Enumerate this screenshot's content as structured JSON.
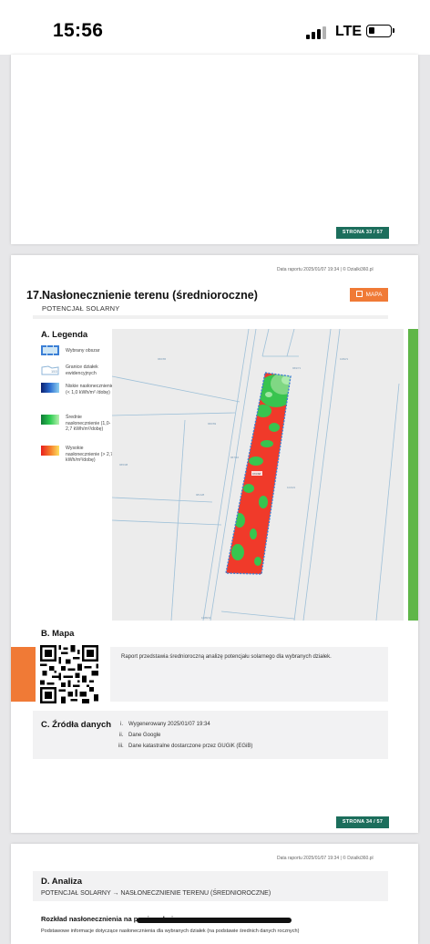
{
  "status_bar": {
    "time": "15:56",
    "network": "LTE",
    "icons": [
      "signal-icon",
      "battery-icon"
    ]
  },
  "page1": {
    "badge": "STRONA 33 / 57"
  },
  "page2": {
    "meta": "Data raportu 2025/01/07 19:34  |  © Dzialki360.pl",
    "section_number": "17.",
    "section_title": "Nasłonecznienie terenu (średnioroczne)",
    "section_subtitle": "POTENCJAŁ SOLARNY",
    "mapa_button": "MAPA",
    "legend": {
      "heading": "A. Legenda",
      "items": [
        {
          "label": "Wybrany obszar",
          "icon": "selected-area-icon"
        },
        {
          "label": "Granice działek ewidencyjnych",
          "icon": "parcel-boundary-icon"
        },
        {
          "label": "Niskie nasłonecznienie (< 1,0 kWh/m² /dobę)",
          "icon": "low-insolation-icon"
        },
        {
          "label": "Średnie nasłonecznienie (1,0- 2,7 kWh/m²/dobę)",
          "icon": "medium-insolation-icon"
        },
        {
          "label": "Wysokie nasłonecznienie (> 2,7 kWh/m²/dobę)",
          "icon": "high-insolation-icon"
        }
      ]
    },
    "map_heading": "B. Mapa",
    "map_description": "Raport przedstawia średnioroczną analizę potencjału solarnego dla wybranych działek.",
    "sources_heading": "C. Źródła danych",
    "sources": [
      {
        "num": "i.",
        "text": "Wygenerowany 2025/01/07 19:34"
      },
      {
        "num": "ii.",
        "text": "Dane Google"
      },
      {
        "num": "iii.",
        "text": "Dane katastralne dostarczone przez GUGiK (EGiB)"
      }
    ],
    "badge": "STRONA 34 / 57",
    "colors": {
      "low": "#1a3fa8",
      "medium": "#2ecc52",
      "high": "#f03a2a",
      "accent": "#f07a36",
      "badge": "#1c6e5c",
      "bar": "#5fb648"
    }
  },
  "page3": {
    "meta": "Data raportu 2025/01/07 19:34  |  © Dzialki360.pl",
    "heading": "D. Analiza",
    "breadcrumb": "POTENCJAŁ SOLARNY → NASŁONECZNIENIE TERENU (ŚREDNIOROCZNE)",
    "subheading": "Rozkład nasłonecznienia na powierzchni",
    "body_partial": "Podstawowe informacje dotyczące nasłonecznienia dla wybranych działek (na podstawie średnich danych rocznych)"
  }
}
